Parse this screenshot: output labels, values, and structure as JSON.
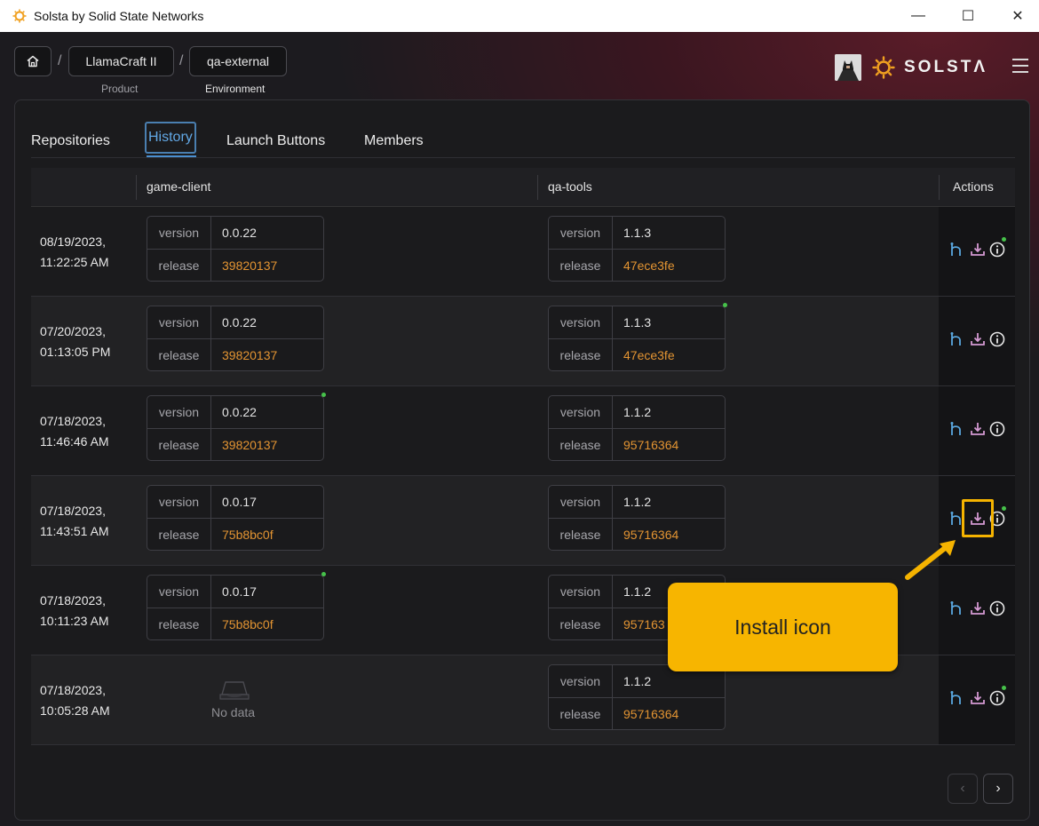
{
  "window": {
    "title": "Solsta by Solid State Networks",
    "minimize": "—",
    "maximize": "☐",
    "close": "✕"
  },
  "breadcrumb": {
    "home_icon": "home-icon",
    "product": "LlamaCraft II",
    "product_caption": "Product",
    "environment": "qa-external",
    "environment_caption": "Environment",
    "separator": "/"
  },
  "brand": {
    "name": "SOLSTΛ",
    "accent": "#e39432"
  },
  "tabs": [
    {
      "label": "Repositories"
    },
    {
      "label": "History",
      "active": true
    },
    {
      "label": "Launch Buttons"
    },
    {
      "label": "Members"
    }
  ],
  "table": {
    "headers": {
      "col1": "game-client",
      "col2": "qa-tools",
      "actions": "Actions"
    },
    "version_label": "version",
    "release_label": "release",
    "no_data": "No data",
    "rows": [
      {
        "date": "08/19/2023,",
        "time": "11:22:25 AM",
        "client": {
          "version": "0.0.22",
          "release": "39820137"
        },
        "tools": {
          "version": "1.1.3",
          "release": "47ece3fe"
        }
      },
      {
        "date": "07/20/2023,",
        "time": "01:13:05 PM",
        "client": {
          "version": "0.0.22",
          "release": "39820137"
        },
        "tools": {
          "version": "1.1.3",
          "release": "47ece3fe"
        }
      },
      {
        "date": "07/18/2023,",
        "time": "11:46:46 AM",
        "client": {
          "version": "0.0.22",
          "release": "39820137"
        },
        "tools": {
          "version": "1.1.2",
          "release": "95716364"
        }
      },
      {
        "date": "07/18/2023,",
        "time": "11:43:51 AM",
        "client": {
          "version": "0.0.17",
          "release": "75b8bc0f"
        },
        "tools": {
          "version": "1.1.2",
          "release": "95716364"
        }
      },
      {
        "date": "07/18/2023,",
        "time": "10:11:23 AM",
        "client": {
          "version": "0.0.17",
          "release": "75b8bc0f"
        },
        "tools": {
          "version": "1.1.2",
          "release": "957163"
        }
      },
      {
        "date": "07/18/2023,",
        "time": "10:05:28 AM",
        "client": null,
        "tools": {
          "version": "1.1.2",
          "release": "95716364"
        }
      }
    ]
  },
  "pagination": {
    "prev": "‹",
    "next": "›"
  },
  "annotation": {
    "callout": "Install icon"
  },
  "colors": {
    "link": "#5aa8e0",
    "install": "#d59ad3",
    "release": "#e39432",
    "callout": "#f7b500"
  }
}
